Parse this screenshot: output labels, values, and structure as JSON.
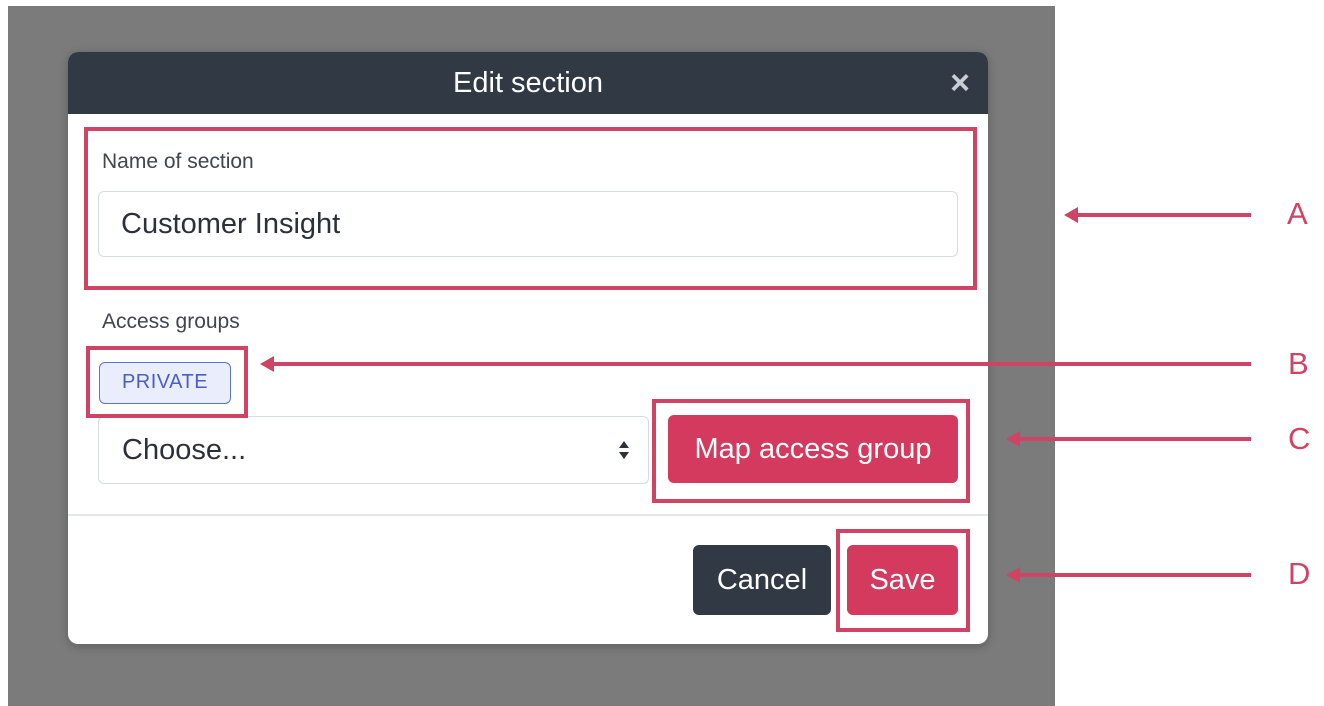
{
  "dialog": {
    "title": "Edit section",
    "close_symbol": "×",
    "name_label": "Name of section",
    "name_value": "Customer Insight",
    "access_label": "Access groups",
    "access_badge": "PRIVATE",
    "select_value": "Choose...",
    "map_button": "Map access group",
    "cancel_button": "Cancel",
    "save_button": "Save"
  },
  "callouts": {
    "a": "A",
    "b": "B",
    "c": "C",
    "d": "D"
  },
  "colors": {
    "header": "#313a44",
    "accent": "#d33a5e",
    "highlight": "#cf4365",
    "badge_border": "#5d73d6",
    "backdrop": "#7b7b7b"
  },
  "icons": {
    "close": "close-icon",
    "select": "select-arrows-icon"
  }
}
